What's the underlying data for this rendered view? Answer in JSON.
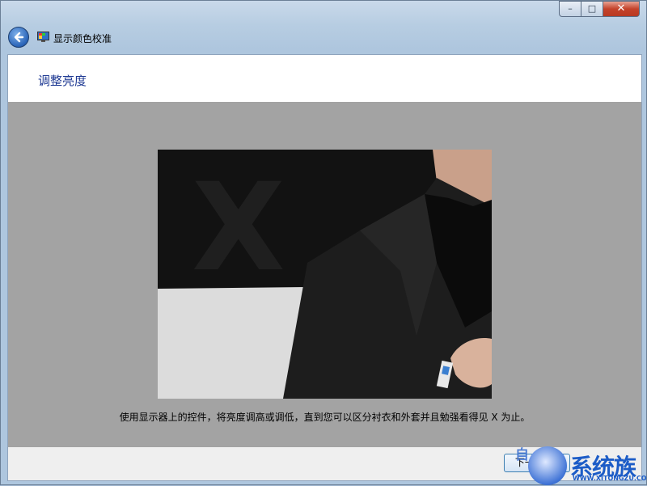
{
  "window": {
    "title": "显示颜色校准",
    "controls": {
      "minimize": "–",
      "maximize": "□",
      "close": "✕"
    }
  },
  "page": {
    "heading": "调整亮度",
    "image_letter": "X",
    "instruction": "使用显示器上的控件，将亮度调高或调低，直到您可以区分衬衣和外套并且勉强看得见 X 为止。"
  },
  "footer": {
    "next_label": "下一步(N)"
  },
  "watermark": {
    "top_text": "自",
    "big_text": "系统族",
    "url": "WWW.XITONGZU.COM"
  },
  "colors": {
    "accent_heading": "#1f3a93",
    "panel_grey": "#a3a3a3",
    "close_red": "#c4432b"
  }
}
